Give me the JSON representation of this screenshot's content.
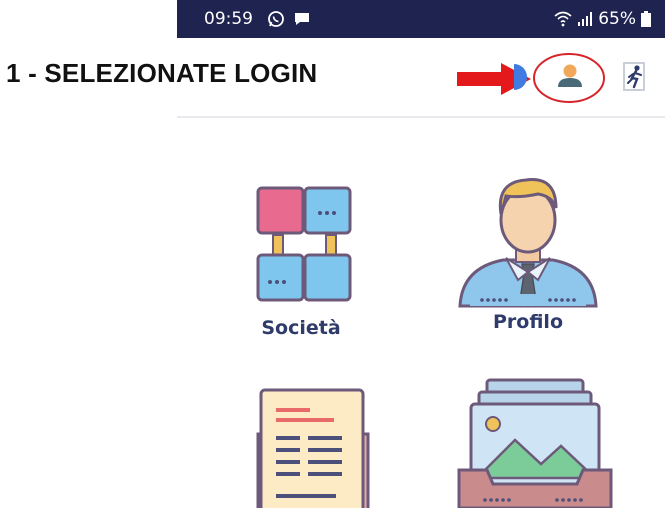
{
  "status_bar": {
    "time": "09:59",
    "battery": "65%",
    "icons": [
      "whatsapp-icon",
      "message-icon",
      "wifi-icon",
      "signal-icon",
      "battery-icon"
    ]
  },
  "annotation": {
    "text": "1 - SELEZIONATE LOGIN",
    "arrow_color": "#e3191c",
    "circle_color": "#d6262b"
  },
  "toolbar": {
    "login_icon": "user-login-icon",
    "logout_icon": "exit-icon"
  },
  "tiles": [
    {
      "label": "Società",
      "icon": "company-network-icon"
    },
    {
      "label": "Profilo",
      "icon": "profile-person-icon"
    },
    {
      "label": "",
      "icon": "document-icon"
    },
    {
      "label": "",
      "icon": "photo-archive-icon"
    }
  ],
  "colors": {
    "status_bar_bg": "#1e2350",
    "label_text": "#2f3b6a",
    "user_icon_head": "#f1a85a",
    "user_icon_body": "#4a6a78"
  }
}
